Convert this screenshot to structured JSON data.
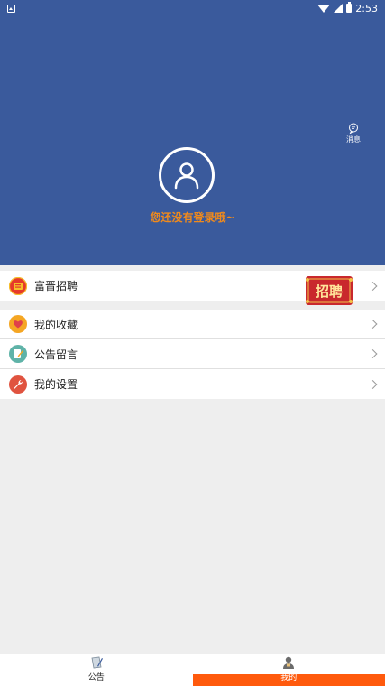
{
  "status_bar": {
    "time": "2:53"
  },
  "header": {
    "message_label": "消息",
    "login_prompt": "您还没有登录哦~"
  },
  "menu": {
    "recruit": {
      "label": "富晋招聘",
      "banner_text": "招聘"
    },
    "items": [
      {
        "label": "我的收藏",
        "icon": "heart-icon",
        "color": "#f5a623"
      },
      {
        "label": "公告留言",
        "icon": "edit-icon",
        "color": "#5fb3a8"
      },
      {
        "label": "我的设置",
        "icon": "wrench-icon",
        "color": "#e0533f"
      }
    ]
  },
  "nav": {
    "items": [
      {
        "label": "公告",
        "icon": "notice-icon",
        "active": false
      },
      {
        "label": "我的",
        "icon": "user-icon",
        "active": true
      }
    ]
  },
  "colors": {
    "primary": "#3a5a9c",
    "accent": "#f08a1c",
    "active_tab": "#ff5a0d"
  }
}
